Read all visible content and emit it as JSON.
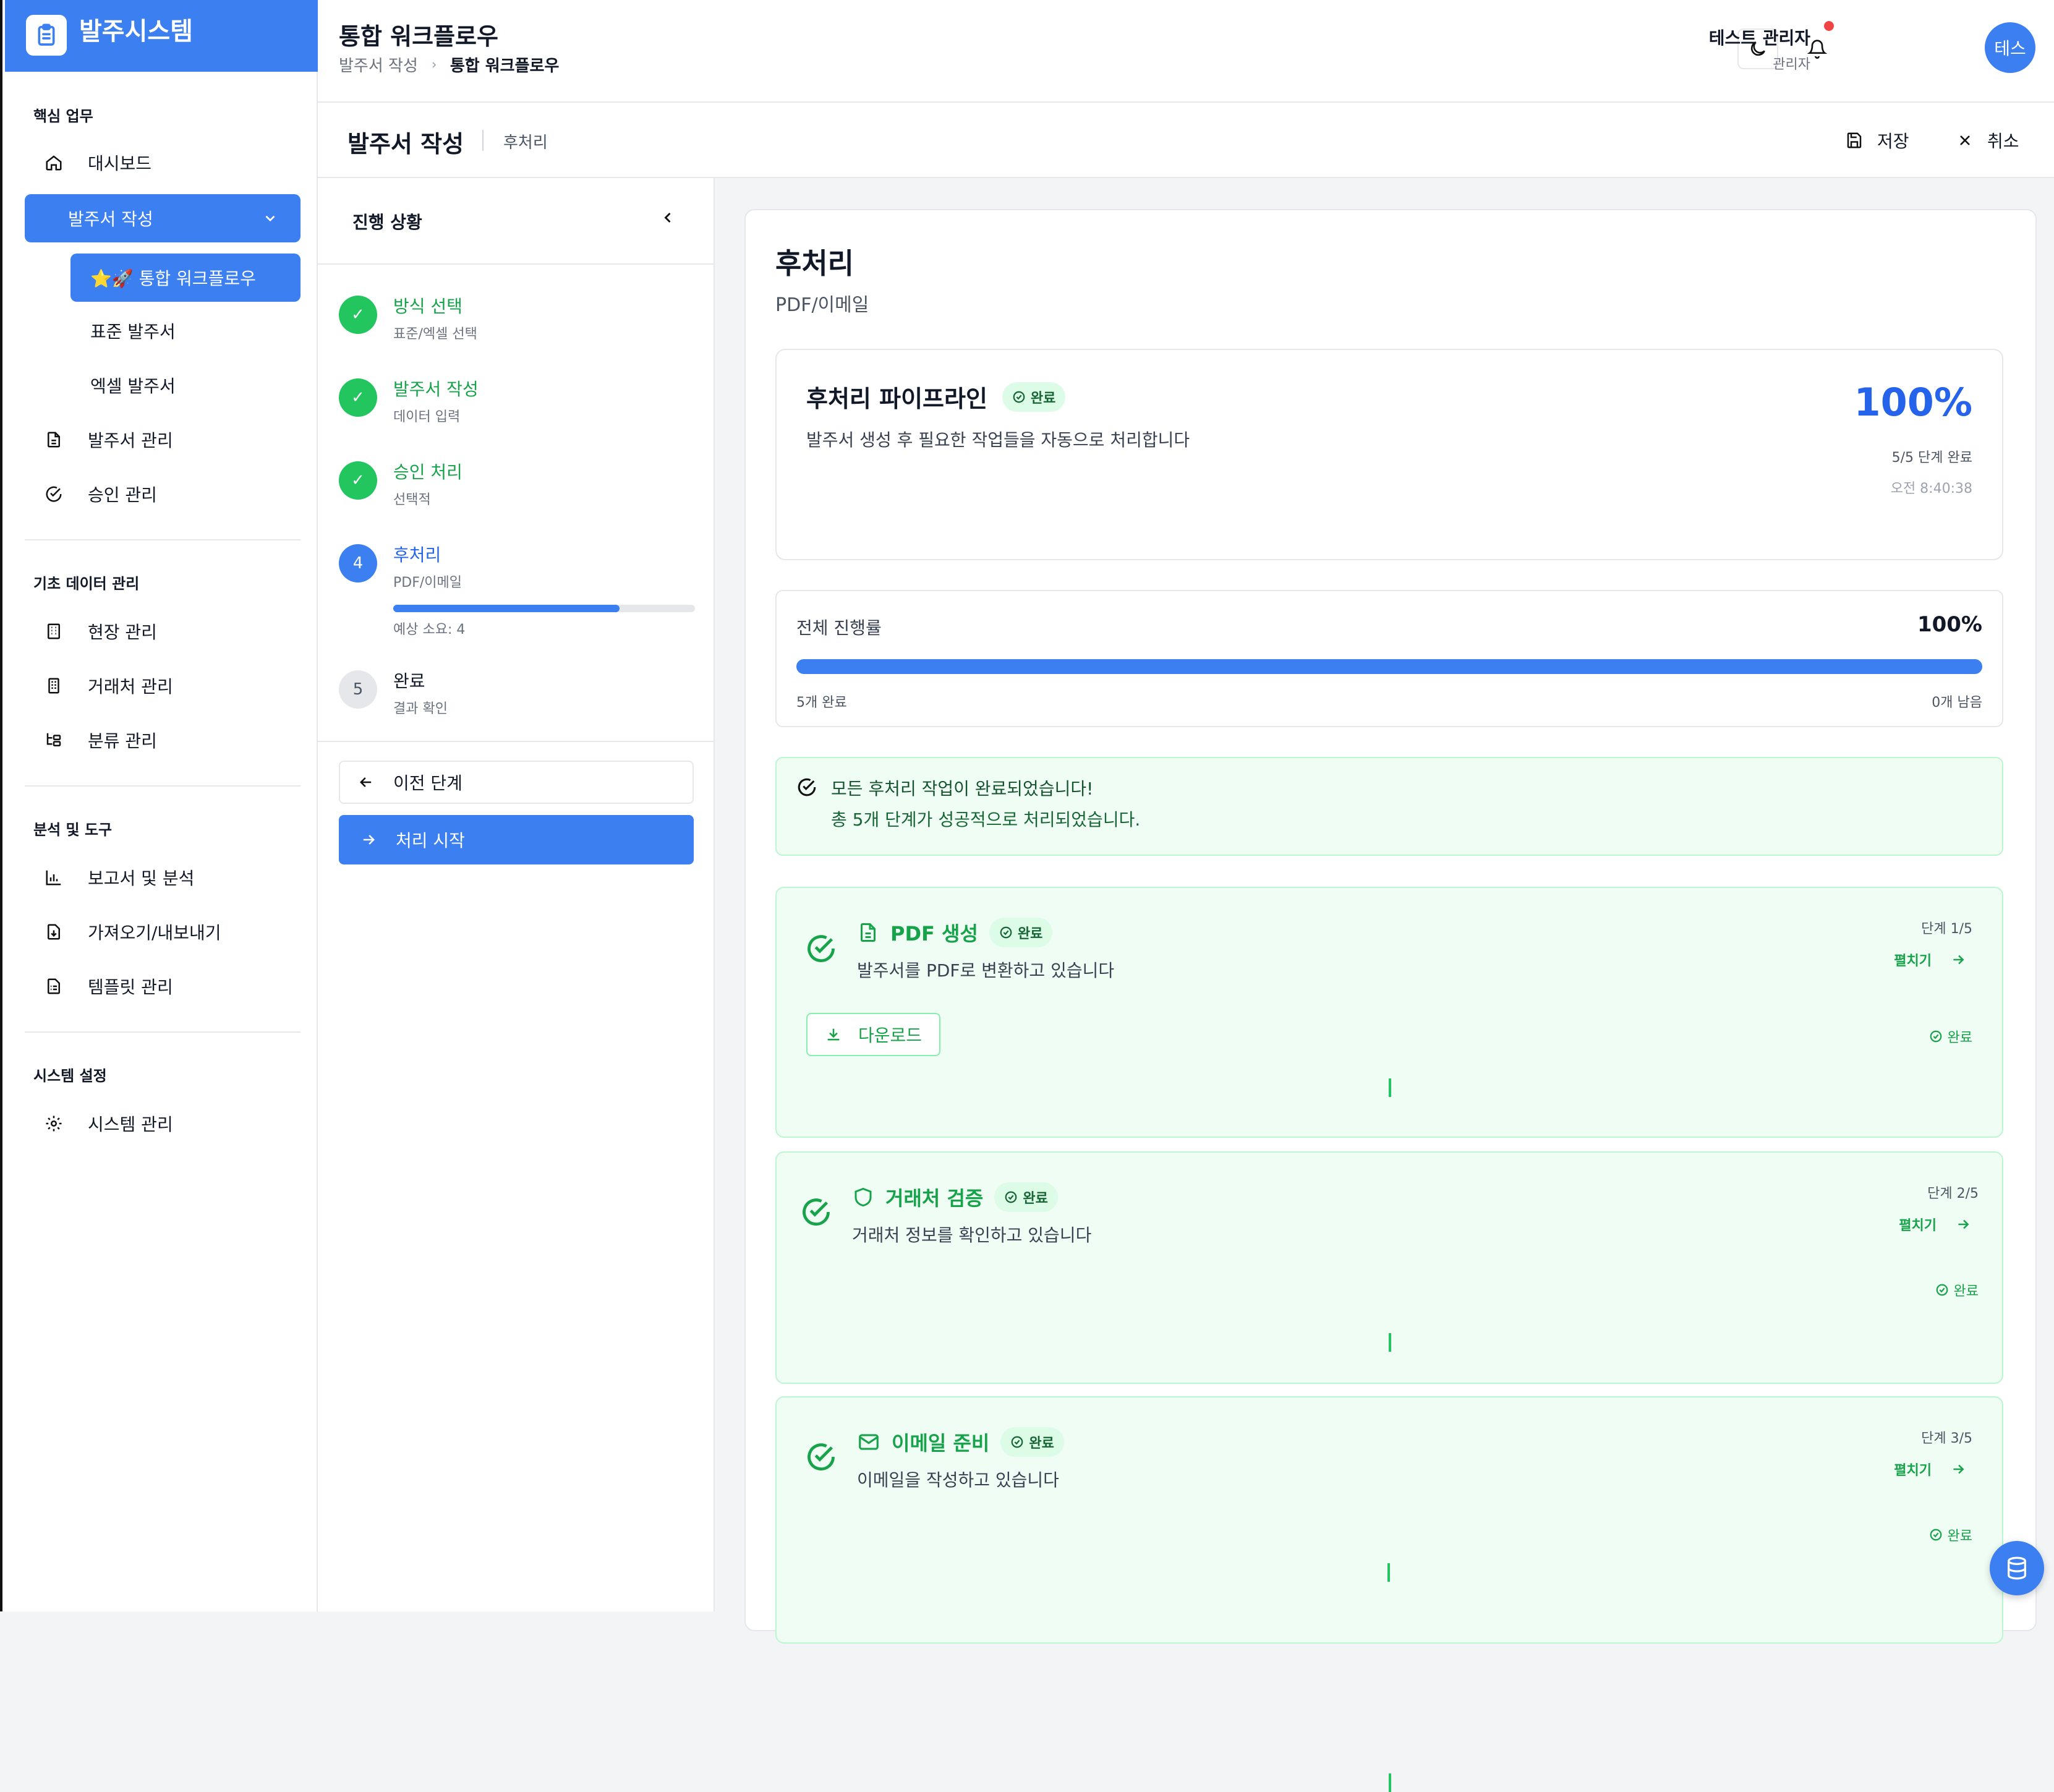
{
  "app": {
    "title": "발주시스템"
  },
  "sidebar": {
    "sections": {
      "core": "핵심 업무",
      "master": "기초 데이터 관리",
      "tools": "분석 및 도구",
      "system": "시스템 설정"
    },
    "items": {
      "dashboard": "대시보드",
      "po_create": "발주서 작성",
      "integrated_workflow": "⭐🚀 통합 워크플로우",
      "standard_po": "표준 발주서",
      "excel_po": "엑셀 발주서",
      "po_manage": "발주서 관리",
      "approval_manage": "승인 관리",
      "site_manage": "현장 관리",
      "vendor_manage": "거래처 관리",
      "category_manage": "분류 관리",
      "reports": "보고서 및 분석",
      "import_export": "가져오기/내보내기",
      "templates": "템플릿 관리",
      "system_manage": "시스템 관리"
    }
  },
  "header": {
    "title": "통합 워크플로우",
    "breadcrumb": [
      "발주서 작성",
      "통합 워크플로우"
    ],
    "user_name": "테스트 관리자",
    "user_role": "관리자",
    "avatar": "테스"
  },
  "subheader": {
    "title": "발주서 작성",
    "step": "후처리",
    "save": "저장",
    "cancel": "취소"
  },
  "progress": {
    "title": "진행 상황",
    "steps": [
      {
        "num": "✓",
        "title": "방식 선택",
        "sub": "표준/엑셀 선택",
        "state": "done"
      },
      {
        "num": "✓",
        "title": "발주서 작성",
        "sub": "데이터 입력",
        "state": "done"
      },
      {
        "num": "✓",
        "title": "승인 처리",
        "sub": "선택적",
        "state": "done"
      },
      {
        "num": "4",
        "title": "후처리",
        "sub": "PDF/이메일",
        "state": "current",
        "eta": "예상 소요: 4",
        "fill": 0.75
      },
      {
        "num": "5",
        "title": "완료",
        "sub": "결과 확인",
        "state": "pending"
      }
    ],
    "prev_button": "이전 단계",
    "start_button": "처리 시작"
  },
  "main": {
    "title": "후처리",
    "subtitle": "PDF/이메일",
    "pipeline": {
      "title": "후처리 파이프라인",
      "badge": "완료",
      "desc": "발주서 생성 후 필요한 작업들을 자동으로 처리합니다",
      "percent": "100%",
      "steps_done": "5/5 단계 완료",
      "time": "오전 8:40:38"
    },
    "overall": {
      "label": "전체 진행률",
      "percent": "100%",
      "fill": 1.0,
      "done": "5개 완료",
      "remaining": "0개 남음"
    },
    "success": {
      "title": "모든 후처리 작업이 완료되었습니다!",
      "desc": "총 5개 단계가 성공적으로 처리되었습니다."
    },
    "tasks": [
      {
        "title": "PDF 생성",
        "badge": "완료",
        "desc": "발주서를 PDF로 변환하고 있습니다",
        "step": "단계 1/5",
        "expand": "펼치기",
        "status": "완료",
        "download": "다운로드"
      },
      {
        "title": "거래처 검증",
        "badge": "완료",
        "desc": "거래처 정보를 확인하고 있습니다",
        "step": "단계 2/5",
        "expand": "펼치기",
        "status": "완료"
      },
      {
        "title": "이메일 준비",
        "badge": "완료",
        "desc": "이메일을 작성하고 있습니다",
        "step": "단계 3/5",
        "expand": "펼치기",
        "status": "완료"
      }
    ]
  },
  "colors": {
    "primary": "#3b7ff0",
    "success": "#22c55e",
    "success_text": "#16a34a"
  }
}
